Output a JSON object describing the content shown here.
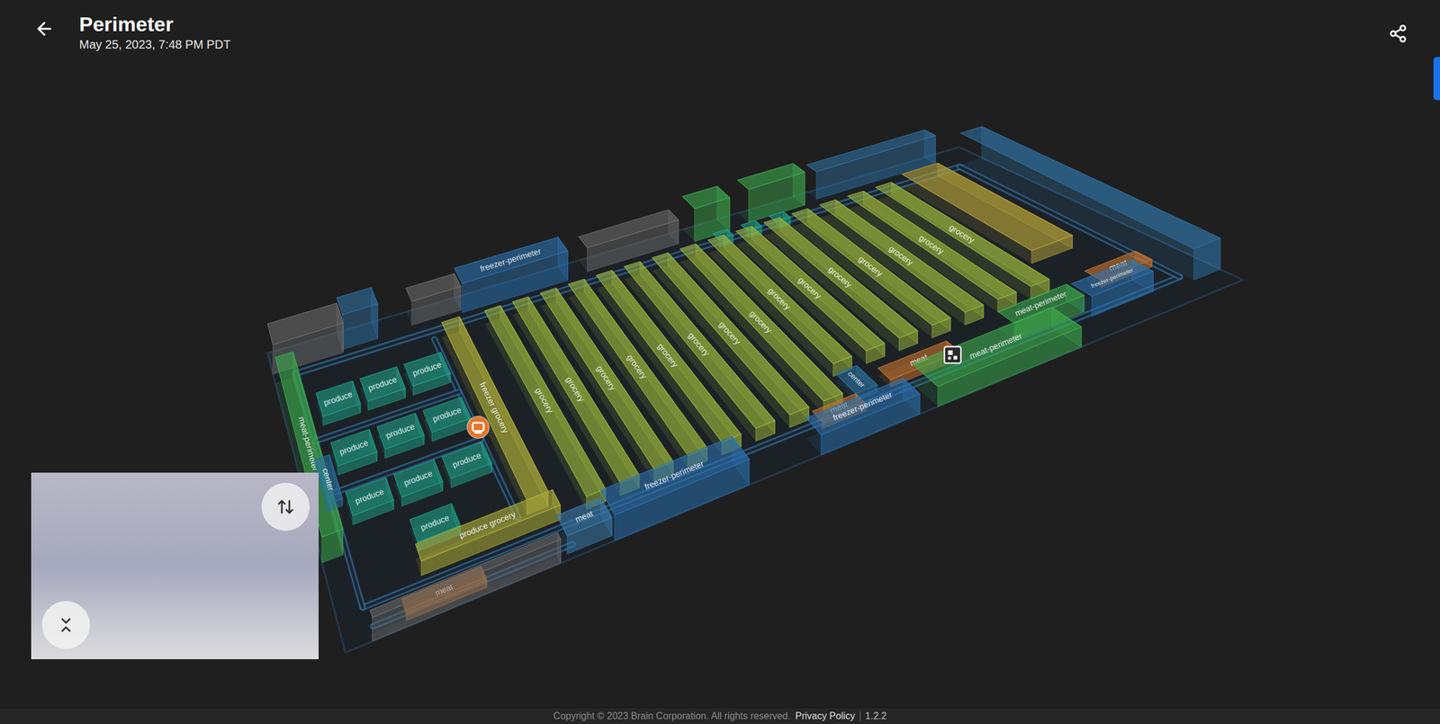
{
  "header": {
    "title": "Perimeter",
    "timestamp": "May 25, 2023, 7:48 PM PDT"
  },
  "map": {
    "zones": [
      {
        "label": "produce",
        "color": "#1f9e86"
      },
      {
        "label": "produce",
        "color": "#1f9e86"
      },
      {
        "label": "produce",
        "color": "#1f9e86"
      },
      {
        "label": "produce",
        "color": "#1f9e86"
      },
      {
        "label": "produce",
        "color": "#1f9e86"
      },
      {
        "label": "produce",
        "color": "#1f9e86"
      },
      {
        "label": "produce",
        "color": "#1f9e86"
      },
      {
        "label": "produce",
        "color": "#1f9e86"
      },
      {
        "label": "produce",
        "color": "#1f9e86"
      },
      {
        "label": "produce",
        "color": "#1f9e86"
      },
      {
        "label": "center",
        "color": "#2a6f9e"
      },
      {
        "label": "freezer grocery",
        "color": "#b3b23a"
      },
      {
        "label": "produce grocery",
        "color": "#b3b23a"
      },
      {
        "label": "meat",
        "color": "#c8742e"
      },
      {
        "label": "meat",
        "color": "#3b7cab"
      },
      {
        "label": "freezer-perimeter",
        "color": "#2b72b0"
      },
      {
        "label": "meat-perimeter",
        "color": "#3daa4c"
      },
      {
        "label": "freezer-perimeter",
        "color": "#2b72b0"
      },
      {
        "label": "grocery",
        "color": "#9bb43c"
      },
      {
        "label": "grocery",
        "color": "#9bb43c"
      },
      {
        "label": "grocery",
        "color": "#9bb43c"
      },
      {
        "label": "grocery",
        "color": "#9bb43c"
      },
      {
        "label": "grocery",
        "color": "#9bb43c"
      },
      {
        "label": "grocery",
        "color": "#9bb43c"
      },
      {
        "label": "grocery",
        "color": "#9bb43c"
      },
      {
        "label": "grocery",
        "color": "#9bb43c"
      },
      {
        "label": "grocery",
        "color": "#9bb43c"
      },
      {
        "label": "grocery",
        "color": "#9bb43c"
      },
      {
        "label": "grocery",
        "color": "#9bb43c"
      },
      {
        "label": "grocery",
        "color": "#9bb43c"
      },
      {
        "label": "grocery",
        "color": "#9bb43c"
      },
      {
        "label": "grocery",
        "color": "#9bb43c"
      },
      {
        "label": "grocery",
        "color": "#9bb43c"
      },
      {
        "label": "center",
        "color": "#2a6f9e"
      },
      {
        "label": "meat",
        "color": "#c8742e"
      },
      {
        "label": "freezer-perimeter",
        "color": "#2b72b0"
      },
      {
        "label": "meat",
        "color": "#c8742e"
      },
      {
        "label": "meat-perimeter",
        "color": "#3daa4c"
      },
      {
        "label": "meat-perimeter",
        "color": "#3daa4c"
      },
      {
        "label": "freezer-perimeter",
        "color": "#2b72b0"
      },
      {
        "label": "meat",
        "color": "#c8742e"
      }
    ],
    "markers": [
      {
        "kind": "robot",
        "color": "#e8742c"
      },
      {
        "kind": "dock",
        "color": "#ffffff"
      }
    ]
  },
  "footer": {
    "copyright": "Copyright © 2023 Brain Corporation. All rights reserved.",
    "links": [
      "Privacy Policy"
    ],
    "version": "1.2.2"
  }
}
